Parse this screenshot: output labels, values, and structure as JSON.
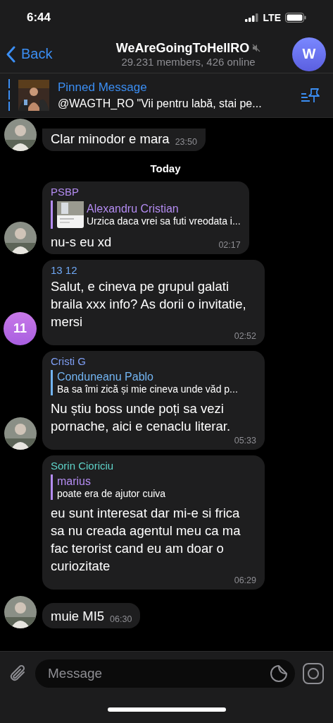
{
  "status_bar": {
    "time": "6:44",
    "network": "LTE"
  },
  "header": {
    "back": "Back",
    "title": "WeAreGoingToHellRO",
    "muted": true,
    "subtitle": "29.231 members, 426 online",
    "avatar_letter": "W"
  },
  "pinned": {
    "title": "Pinned Message",
    "text": "@WAGTH_RO \"Vii pentru labă, stai pe..."
  },
  "messages": [
    {
      "text": "Clar minodor e mara",
      "time": "23:50"
    },
    {
      "kind": "date",
      "label": "Today"
    },
    {
      "sender": "PSBP",
      "color": "#b48cf2",
      "reply": {
        "name": "Alexandru Cristian",
        "text": "Urzica daca vrei sa futi vreodata i...",
        "color": "#b48cf2",
        "thumbnail": true
      },
      "text": "nu-s eu xd",
      "time": "02:17"
    },
    {
      "sender": "13 12",
      "color": "#6fa8f5",
      "text": "Salut, e cineva pe grupul galati braila xxx info? As dorii o invitatie, mersi",
      "time": "02:52",
      "avatar": {
        "kind": "initials",
        "text": "11",
        "color": "#c879e8"
      }
    },
    {
      "sender": "Cristi G",
      "color": "#7f9ff5",
      "reply": {
        "name": "Conduneanu Pablo",
        "text": "Ba sa îmi zică și mie cineva unde văd p...",
        "color": "#72b4f2",
        "thumbnail": false
      },
      "text": "Nu știu boss unde poți sa vezi pornache, aici e cenaclu literar.",
      "time": "05:33"
    },
    {
      "sender": "Sorin Cioriciu",
      "color": "#5fd3c9",
      "reply": {
        "name": "marius",
        "text": "poate era de ajutor cuiva",
        "color": "#b48cf2",
        "thumbnail": false
      },
      "text": "eu sunt interesat dar mi-e si frica sa nu creada agentul meu ca ma fac terorist cand eu am doar o curiozitate",
      "time": "06:29"
    },
    {
      "text": "muie MI5",
      "time": "06:30"
    }
  ],
  "composer": {
    "placeholder": "Message"
  }
}
